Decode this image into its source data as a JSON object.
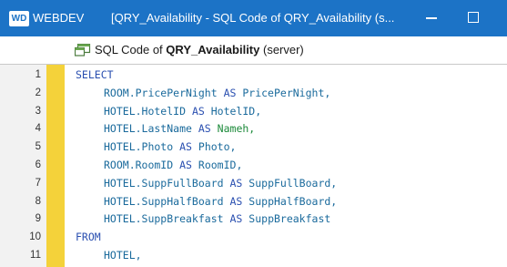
{
  "titlebar": {
    "logo": "WD",
    "app_name": "WEBDEV",
    "window_title": "[QRY_Availability - SQL Code of QRY_Availability (s...",
    "accent": "#1c73c6"
  },
  "header": {
    "icon": "query-window-icon",
    "prefix": "SQL Code of ",
    "query_name": "QRY_Availability",
    "suffix": " (server)"
  },
  "colors": {
    "keyword": "#2a4fb0",
    "identifier": "#1a6a9c",
    "highlight_alias": "#1c8a3a",
    "marker": "#f4d23a"
  },
  "editor": {
    "lines": [
      {
        "num": "1",
        "kw": "SELECT",
        "expr": "",
        "as": "",
        "alias": ""
      },
      {
        "num": "2",
        "kw": "",
        "expr": "ROOM.PricePerNight",
        "as": "AS",
        "alias": "PricePerNight,"
      },
      {
        "num": "3",
        "kw": "",
        "expr": "HOTEL.HotelID",
        "as": "AS",
        "alias": "HotelID,"
      },
      {
        "num": "4",
        "kw": "",
        "expr": "HOTEL.LastName",
        "as": "AS",
        "alias": "Nameh,"
      },
      {
        "num": "5",
        "kw": "",
        "expr": "HOTEL.Photo",
        "as": "AS",
        "alias": "Photo,"
      },
      {
        "num": "6",
        "kw": "",
        "expr": "ROOM.RoomID",
        "as": "AS",
        "alias": "RoomID,"
      },
      {
        "num": "7",
        "kw": "",
        "expr": "HOTEL.SuppFullBoard",
        "as": "AS",
        "alias": "SuppFullBoard,"
      },
      {
        "num": "8",
        "kw": "",
        "expr": "HOTEL.SuppHalfBoard",
        "as": "AS",
        "alias": "SuppHalfBoard,"
      },
      {
        "num": "9",
        "kw": "",
        "expr": "HOTEL.SuppBreakfast",
        "as": "AS",
        "alias": "SuppBreakfast"
      },
      {
        "num": "10",
        "kw": "FROM",
        "expr": "",
        "as": "",
        "alias": ""
      },
      {
        "num": "11",
        "kw": "",
        "expr": "HOTEL,",
        "as": "",
        "alias": ""
      }
    ]
  }
}
